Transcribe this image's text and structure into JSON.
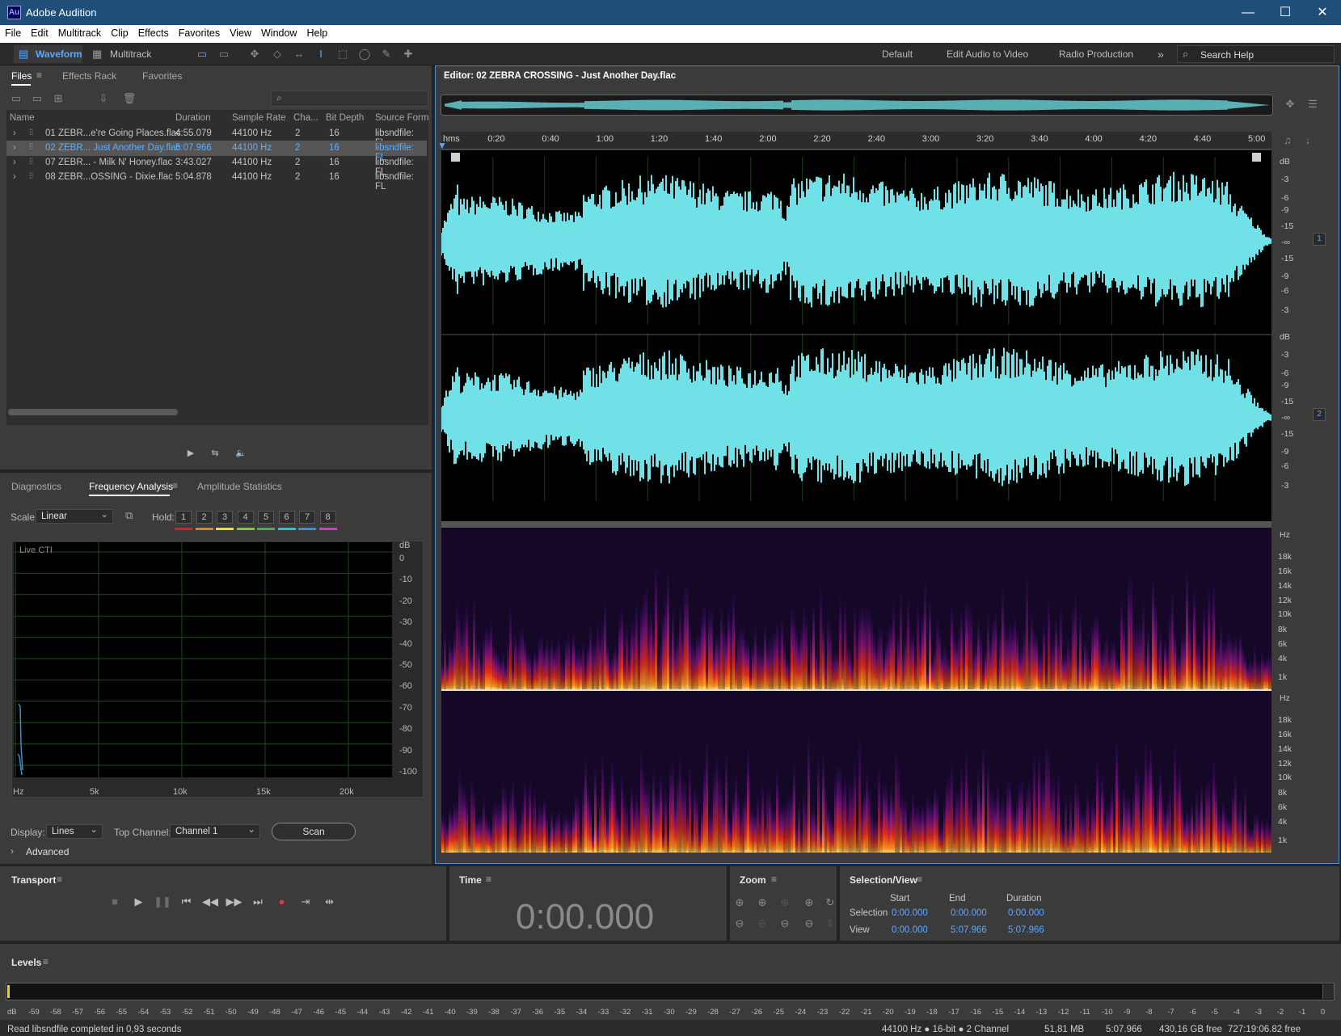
{
  "window": {
    "title": "Adobe Audition",
    "logo": "Au",
    "minimize": "—",
    "maximize": "☐",
    "close": "✕"
  },
  "menu": [
    "File",
    "Edit",
    "Multitrack",
    "Clip",
    "Effects",
    "Favorites",
    "View",
    "Window",
    "Help"
  ],
  "toolbar": {
    "waveform": "Waveform",
    "multitrack": "Multitrack",
    "workspaces": [
      "Default",
      "Edit Audio to Video",
      "Radio Production"
    ],
    "more": "»",
    "search_placeholder": "Search Help"
  },
  "files_panel": {
    "tabs": [
      "Files",
      "Effects Rack",
      "Favorites"
    ],
    "menu_icon": "≡",
    "columns": [
      "Name",
      "Duration",
      "Sample Rate",
      "Cha...",
      "Bit Depth",
      "Source Form"
    ],
    "rows": [
      {
        "name": "01 ZEBR...e're Going Places.flac",
        "duration": "4:55.079",
        "rate": "44100 Hz",
        "ch": "2",
        "bits": "16",
        "source": "libsndfile: FL"
      },
      {
        "name": "02 ZEBR... Just Another Day.flac",
        "duration": "5:07.966",
        "rate": "44100 Hz",
        "ch": "2",
        "bits": "16",
        "source": "libsndfile: FL"
      },
      {
        "name": "07 ZEBR... - Milk N' Honey.flac",
        "duration": "3:43.027",
        "rate": "44100 Hz",
        "ch": "2",
        "bits": "16",
        "source": "libsndfile: FL"
      },
      {
        "name": "08 ZEBR...OSSING - Dixie.flac",
        "duration": "5:04.878",
        "rate": "44100 Hz",
        "ch": "2",
        "bits": "16",
        "source": "libsndfile: FL"
      }
    ],
    "selected_index": 1
  },
  "analysis_panel": {
    "tabs": [
      "Diagnostics",
      "Frequency Analysis",
      "Amplitude Statistics"
    ],
    "scale_label": "Scale:",
    "scale_value": "Linear",
    "hold_label": "Hold:",
    "holds": [
      "1",
      "2",
      "3",
      "4",
      "5",
      "6",
      "7",
      "8"
    ],
    "hold_colors": [
      "#e81b1b",
      "#f07f12",
      "#f2e407",
      "#7bd317",
      "#3cb54a",
      "#18c9d6",
      "#2f8ef0",
      "#e02ee0"
    ],
    "graph_label": "Live CTI",
    "db_label": "dB",
    "db_ticks": [
      "0",
      "-10",
      "-20",
      "-30",
      "-40",
      "-50",
      "-60",
      "-70",
      "-80",
      "-90",
      "-100"
    ],
    "hz_ticks": [
      "Hz",
      "5k",
      "10k",
      "15k",
      "20k"
    ],
    "display_label": "Display:",
    "display_value": "Lines",
    "top_channel_label": "Top Channel:",
    "top_channel_value": "Channel 1",
    "scan": "Scan",
    "advanced": "Advanced"
  },
  "editor": {
    "title": "Editor: 02 ZEBRA CROSSING - Just Another Day.flac",
    "menu_icon": "≡",
    "ruler": [
      "hms",
      "0:20",
      "0:40",
      "1:00",
      "1:20",
      "1:40",
      "2:00",
      "2:20",
      "2:40",
      "3:00",
      "3:20",
      "3:40",
      "4:00",
      "4:20",
      "4:40",
      "5:00"
    ],
    "db_ticks": [
      "dB",
      "-3",
      "-6",
      "-9",
      "-15",
      "-∞",
      "-15",
      "-9",
      "-6",
      "-3"
    ],
    "hz_ticks": [
      "Hz",
      "18k",
      "16k",
      "14k",
      "12k",
      "10k",
      "8k",
      "6k",
      "4k",
      "1k"
    ],
    "channels": [
      "1",
      "2"
    ],
    "waveform_color": "#70e1e6"
  },
  "transport": {
    "title": "Transport",
    "menu_icon": "≡",
    "buttons": [
      "■",
      "▶",
      "❚❚",
      "⏮",
      "◀◀",
      "▶▶",
      "⏭",
      "●",
      "⇥",
      "⇹"
    ]
  },
  "time": {
    "title": "Time",
    "menu_icon": "≡",
    "value": "0:00.000"
  },
  "zoom": {
    "title": "Zoom",
    "menu_icon": "≡"
  },
  "selection": {
    "title": "Selection/View",
    "menu_icon": "≡",
    "headers": [
      "Start",
      "End",
      "Duration"
    ],
    "selection_label": "Selection",
    "view_label": "View",
    "selection_values": [
      "0:00.000",
      "0:00.000",
      "0:00.000"
    ],
    "view_values": [
      "0:00.000",
      "5:07.966",
      "5:07.966"
    ]
  },
  "levels": {
    "title": "Levels",
    "menu_icon": "≡",
    "scale": [
      "dB",
      "-59",
      "-58",
      "-57",
      "-56",
      "-55",
      "-54",
      "-53",
      "-52",
      "-51",
      "-50",
      "-49",
      "-48",
      "-47",
      "-46",
      "-45",
      "-44",
      "-43",
      "-42",
      "-41",
      "-40",
      "-39",
      "-38",
      "-37",
      "-36",
      "-35",
      "-34",
      "-33",
      "-32",
      "-31",
      "-30",
      "-29",
      "-28",
      "-27",
      "-26",
      "-25",
      "-24",
      "-23",
      "-22",
      "-21",
      "-20",
      "-19",
      "-18",
      "-17",
      "-16",
      "-15",
      "-14",
      "-13",
      "-12",
      "-11",
      "-10",
      "-9",
      "-8",
      "-7",
      "-6",
      "-5",
      "-4",
      "-3",
      "-2",
      "-1",
      "0"
    ]
  },
  "status": {
    "message": "Read libsndfile completed in 0,93 seconds",
    "format": "44100 Hz ● 16-bit ● 2 Channel",
    "size": "51,81 MB",
    "duration": "5:07.966",
    "free": "430,16 GB free",
    "free_time": "727:19:06.82 free"
  }
}
